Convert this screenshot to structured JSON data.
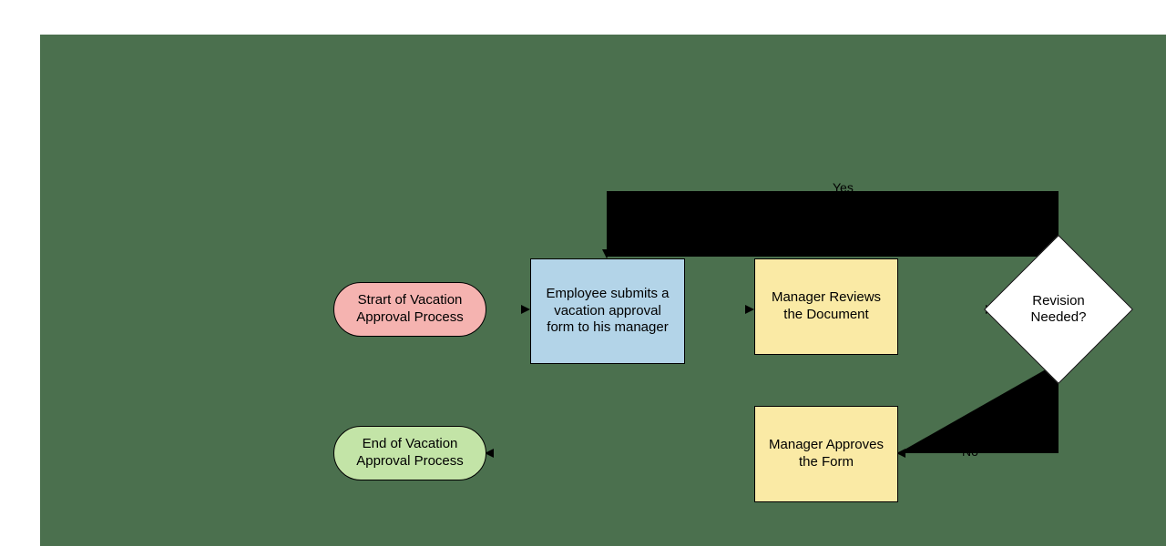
{
  "diagram": {
    "start": {
      "label": "Strart of Vacation Approval Process"
    },
    "submit": {
      "label": "Employee submits a vacation approval form to his manager"
    },
    "review": {
      "label": "Manager Reviews the Document"
    },
    "decision": {
      "label": "Revision Needed?"
    },
    "approve": {
      "label": "Manager Approves the Form"
    },
    "end": {
      "label": "End of Vacation Approval Process"
    },
    "edges": {
      "yes": "Yes",
      "no": "No"
    },
    "colors": {
      "start_fill": "#f5b3b0",
      "submit_fill": "#b3d4e8",
      "process_fill": "#faeaa5",
      "end_fill": "#c3e4a7",
      "decision_fill": "#ffffff",
      "canvas_bg": "#4b704e"
    }
  }
}
